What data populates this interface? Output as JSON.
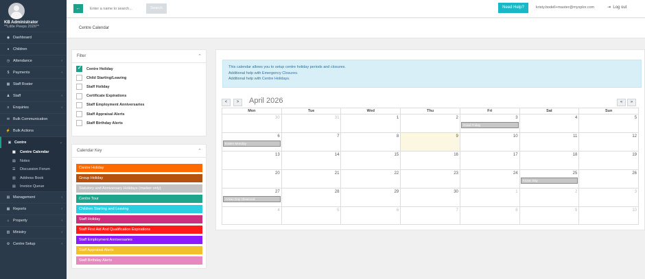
{
  "sidebar": {
    "user_name": "KB Administrator",
    "user_sub": "**Little Peeps 2026**",
    "items": [
      {
        "label": "Dashboard",
        "icon": "dashboard-icon",
        "glyph": "◉",
        "chevron": false
      },
      {
        "label": "Children",
        "icon": "child-icon",
        "glyph": "♦",
        "chevron": false
      },
      {
        "label": "Attendance",
        "icon": "clock-icon",
        "glyph": "◷",
        "chevron": true
      },
      {
        "label": "Payments",
        "icon": "dollar-icon",
        "glyph": "$",
        "chevron": true
      },
      {
        "label": "Staff Roster",
        "icon": "roster-icon",
        "glyph": "▦",
        "chevron": false
      },
      {
        "label": "Staff",
        "icon": "staff-icon",
        "glyph": "♟",
        "chevron": true
      },
      {
        "label": "Enquiries",
        "icon": "enquiries-icon",
        "glyph": "≡",
        "chevron": true
      },
      {
        "label": "Bulk Communication",
        "icon": "megaphone-icon",
        "glyph": "✉",
        "chevron": false
      },
      {
        "label": "Bulk Actions",
        "icon": "bolt-icon",
        "glyph": "⚡",
        "chevron": false
      }
    ],
    "centre": {
      "label": "Centre",
      "icon": "building-icon",
      "glyph": "▣",
      "subitems": [
        {
          "label": "Centre Calendar",
          "icon": "calendar-icon",
          "glyph": "▦",
          "active": true
        },
        {
          "label": "Notes",
          "icon": "notes-icon",
          "glyph": "▤",
          "active": false
        },
        {
          "label": "Discussion Forum",
          "icon": "forum-icon",
          "glyph": "☰",
          "active": false
        },
        {
          "label": "Address Book",
          "icon": "address-book-icon",
          "glyph": "▥",
          "active": false
        },
        {
          "label": "Invoice Queue",
          "icon": "invoice-icon",
          "glyph": "▤",
          "active": false
        }
      ]
    },
    "items_bottom": [
      {
        "label": "Management",
        "icon": "management-icon",
        "glyph": "▤",
        "chevron": true
      },
      {
        "label": "Reports",
        "icon": "reports-icon",
        "glyph": "▦",
        "chevron": true
      },
      {
        "label": "Property",
        "icon": "home-icon",
        "glyph": "⌂",
        "chevron": true
      },
      {
        "label": "Ministry",
        "icon": "ministry-icon",
        "glyph": "▥",
        "chevron": true
      },
      {
        "label": "Centre Setup",
        "icon": "gear-icon",
        "glyph": "⚙",
        "chevron": true
      }
    ]
  },
  "topbar": {
    "search_placeholder": "Enter a name to search...",
    "search_label": "Search",
    "help_label": "Need Help?",
    "user_email": "kristy.bodell+master@myxplor.com",
    "logout_label": "Log out"
  },
  "page_title": "Centre Calendar",
  "filter": {
    "title": "Filter",
    "items": [
      {
        "label": "Centre Holiday",
        "checked": true
      },
      {
        "label": "Child Starting/Leaving",
        "checked": false
      },
      {
        "label": "Staff Holiday",
        "checked": false
      },
      {
        "label": "Certificate Expirations",
        "checked": false
      },
      {
        "label": "Staff Employment Anniversaries",
        "checked": false
      },
      {
        "label": "Staff Appraisal Alerts",
        "checked": false
      },
      {
        "label": "Staff Birthday Alerts",
        "checked": false
      }
    ]
  },
  "calendar_key": {
    "title": "Calendar Key",
    "items": [
      {
        "label": "Centre Holiday",
        "color": "#ff6a00"
      },
      {
        "label": "Group Holiday",
        "color": "#b5520e"
      },
      {
        "label": "Statutory and Anniversary Holidays (marker only)",
        "color": "#c2c2c2"
      },
      {
        "label": "Centre Tour",
        "color": "#1fa58c"
      },
      {
        "label": "Children Starting and Leaving",
        "color": "#29cfe0"
      },
      {
        "label": "Staff Holiday",
        "color": "#cc2f7e"
      },
      {
        "label": "Staff First Aid And Qualification Expirations",
        "color": "#ff1a1a"
      },
      {
        "label": "Staff Employment Anniversaries",
        "color": "#8c1aff"
      },
      {
        "label": "Staff Appraisal Alerts",
        "color": "#f2c02c"
      },
      {
        "label": "Staff Birthday Alerts",
        "color": "#e689c0"
      }
    ]
  },
  "info": {
    "line1": "This calendar allows you to setup centre holiday periods and closures.",
    "line2_prefix": "Additional help with ",
    "line2_link": "Emergency Closures.",
    "line3_prefix": "Additional help with ",
    "line3_link": "Centre Holidays."
  },
  "calendar": {
    "month_label": "April 2026",
    "prev": "<",
    "next": ">",
    "prev_year": "«",
    "next_year": "»",
    "days_of_week": [
      "Mon",
      "Tue",
      "Wed",
      "Thu",
      "Fri",
      "Sat",
      "Sun"
    ],
    "weeks": [
      [
        {
          "d": "30",
          "o": true
        },
        {
          "d": "31",
          "o": true
        },
        {
          "d": "1"
        },
        {
          "d": "2"
        },
        {
          "d": "3",
          "e": "Good Friday"
        },
        {
          "d": "4"
        },
        {
          "d": "5"
        }
      ],
      [
        {
          "d": "6",
          "e": "Easter Monday"
        },
        {
          "d": "7"
        },
        {
          "d": "8"
        },
        {
          "d": "9",
          "t": true
        },
        {
          "d": "10"
        },
        {
          "d": "11"
        },
        {
          "d": "12"
        }
      ],
      [
        {
          "d": "13"
        },
        {
          "d": "14"
        },
        {
          "d": "15"
        },
        {
          "d": "16"
        },
        {
          "d": "17"
        },
        {
          "d": "18"
        },
        {
          "d": "19"
        }
      ],
      [
        {
          "d": "20"
        },
        {
          "d": "21"
        },
        {
          "d": "22"
        },
        {
          "d": "23"
        },
        {
          "d": "24"
        },
        {
          "d": "25",
          "e": "Anzac Day"
        },
        {
          "d": "26"
        }
      ],
      [
        {
          "d": "27",
          "e": "Anzac Day Observed"
        },
        {
          "d": "28"
        },
        {
          "d": "29"
        },
        {
          "d": "30"
        },
        {
          "d": "1",
          "o": true
        },
        {
          "d": "2",
          "o": true
        },
        {
          "d": "3",
          "o": true
        }
      ],
      [
        {
          "d": "4",
          "o": true
        },
        {
          "d": "5",
          "o": true
        },
        {
          "d": "6",
          "o": true
        },
        {
          "d": "7",
          "o": true
        },
        {
          "d": "8",
          "o": true
        },
        {
          "d": "9",
          "o": true
        },
        {
          "d": "10",
          "o": true
        }
      ]
    ]
  }
}
